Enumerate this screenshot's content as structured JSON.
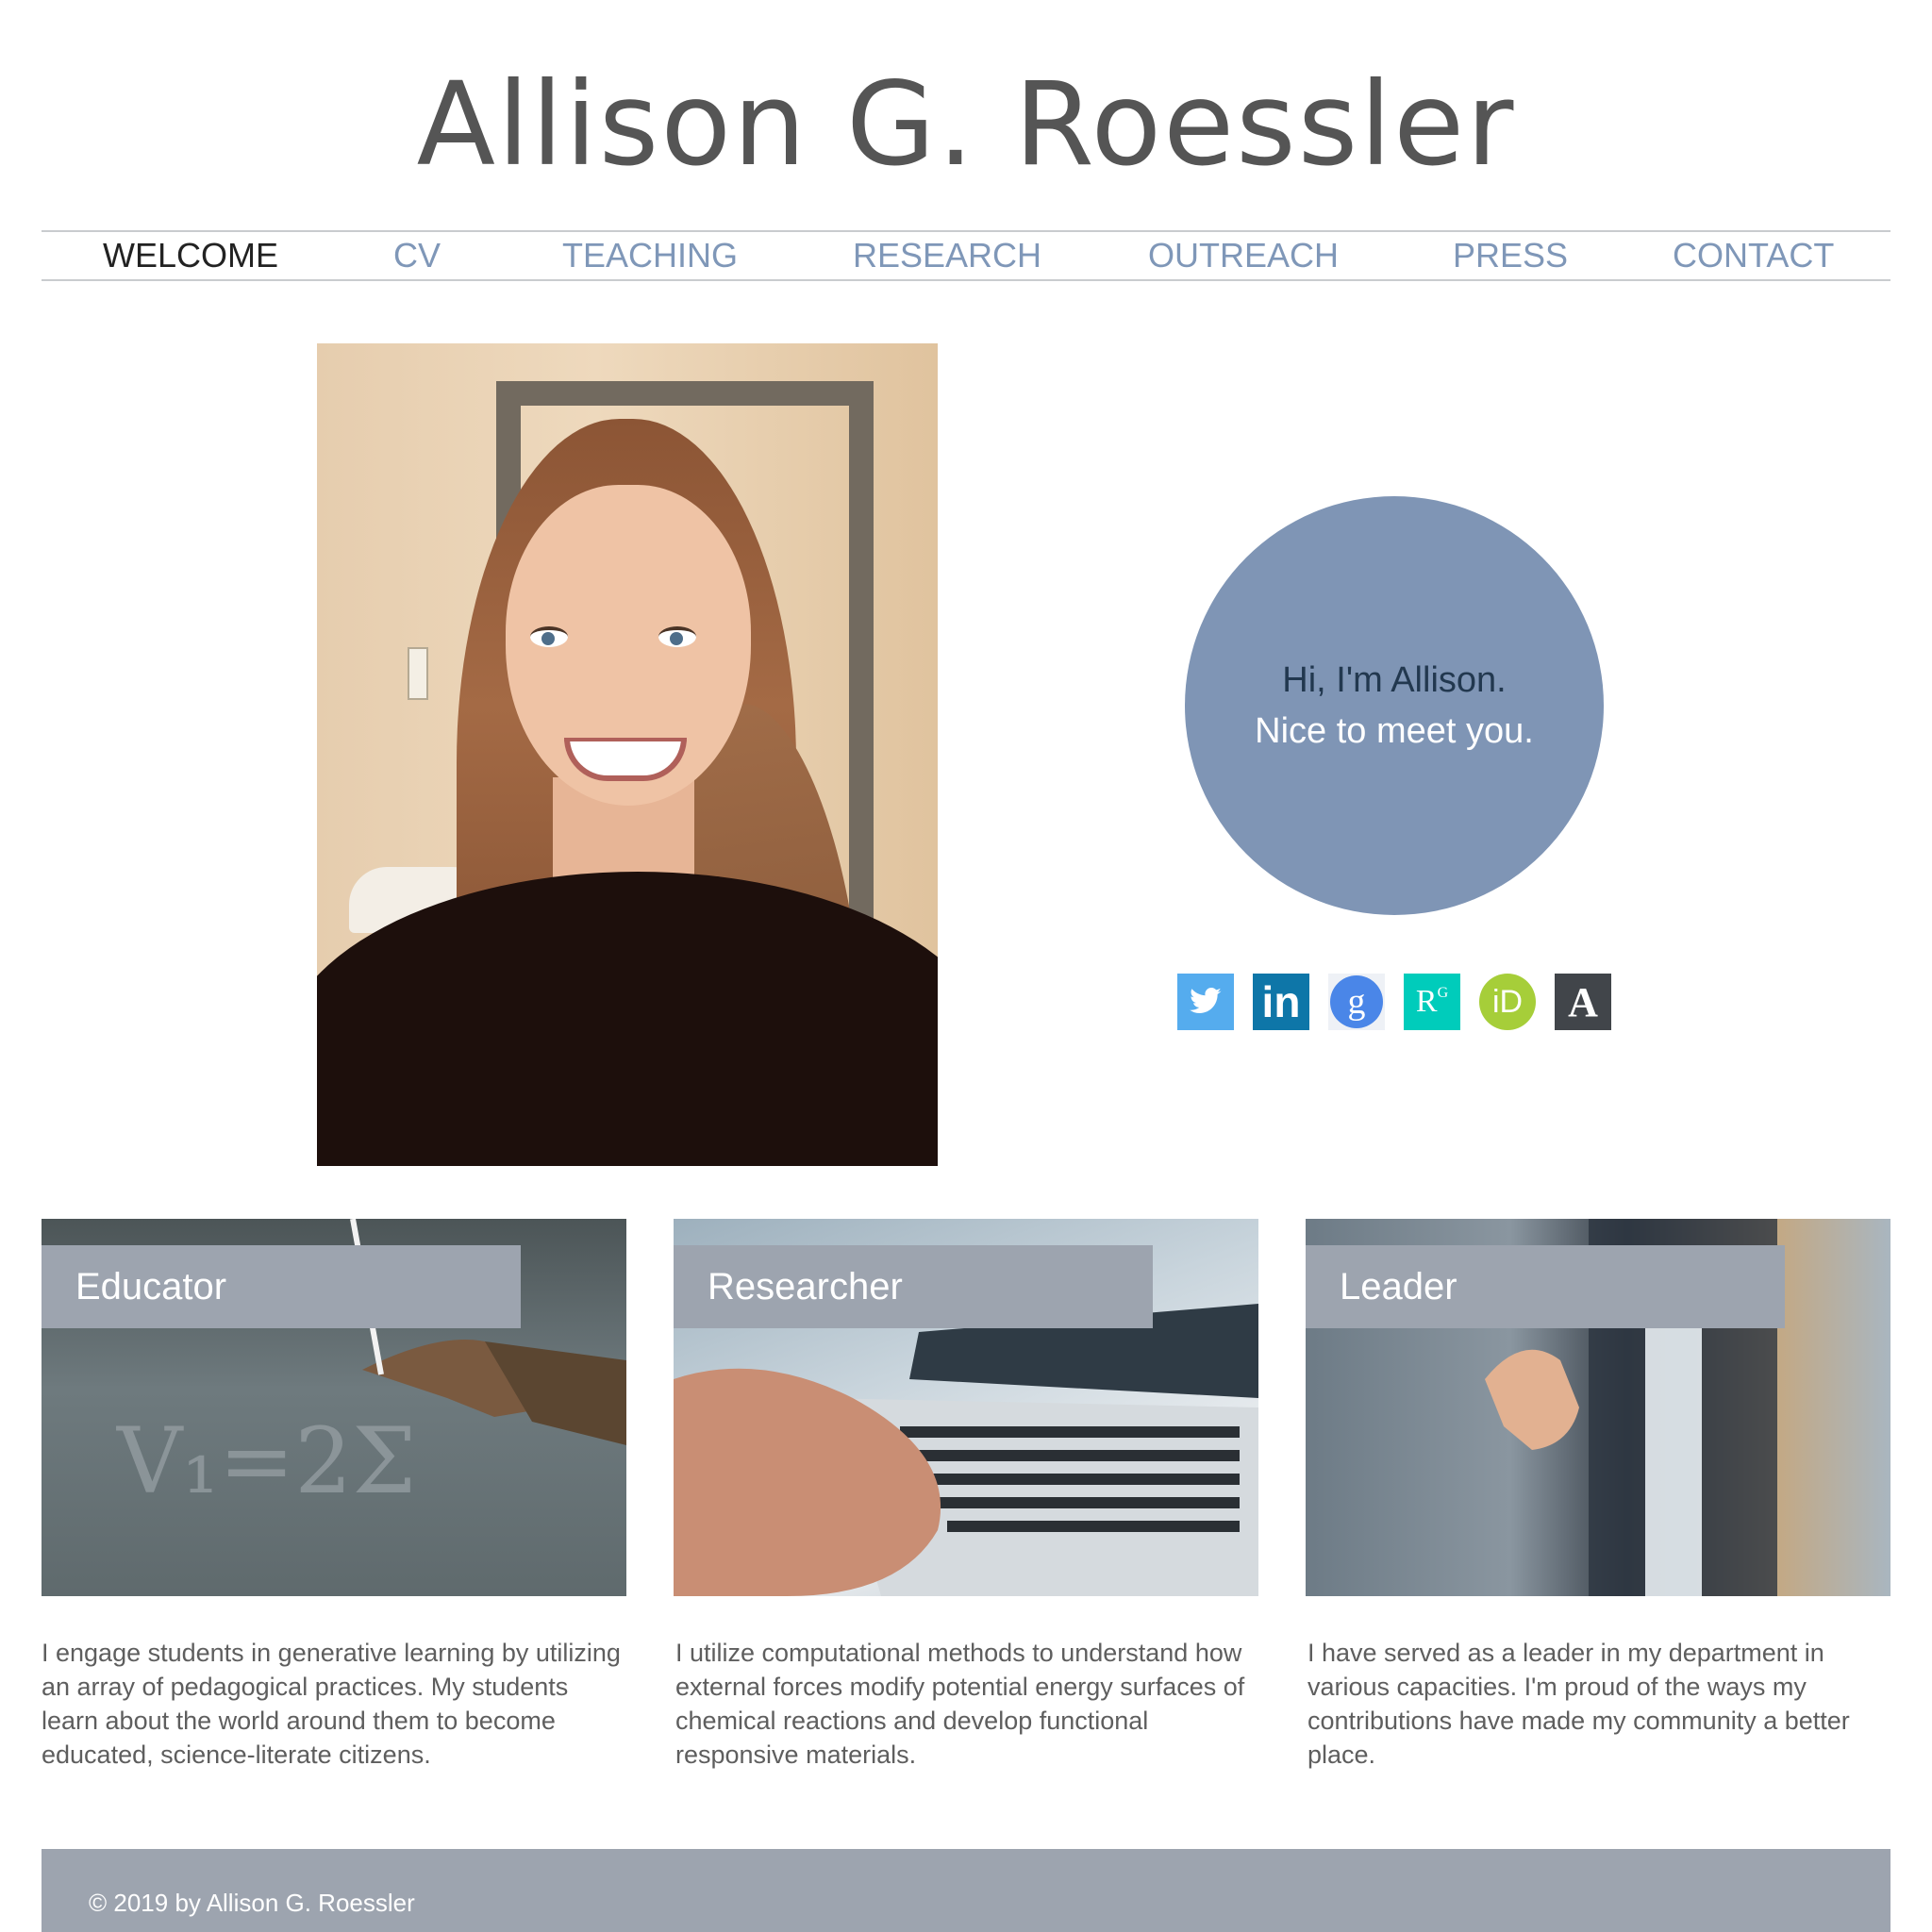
{
  "site": {
    "title": "Allison G. Roessler"
  },
  "nav": {
    "items": [
      {
        "label": "WELCOME",
        "active": true
      },
      {
        "label": "CV"
      },
      {
        "label": "TEACHING"
      },
      {
        "label": "RESEARCH"
      },
      {
        "label": "OUTREACH"
      },
      {
        "label": "PRESS"
      },
      {
        "label": "CONTACT"
      }
    ]
  },
  "hero": {
    "greeting_line1": "Hi, I'm Allison.",
    "greeting_line2": "Nice to meet you."
  },
  "social": {
    "icons": [
      "twitter-icon",
      "linkedin-icon",
      "google-scholar-icon",
      "researchgate-icon",
      "orcid-icon",
      "academia-icon"
    ],
    "researchgate_text": "R",
    "orcid_text": "iD",
    "academia_text": "A",
    "linkedin_text": "in",
    "colors": {
      "twitter": "#55acee",
      "linkedin": "#0e76a8",
      "google_scholar": "#4a86e8",
      "researchgate": "#00ccbb",
      "orcid": "#a6ce39",
      "academia": "#41454a"
    }
  },
  "cards": [
    {
      "label": "Educator",
      "text": "I engage students in generative learning by utilizing an array of pedagogical practices. My students learn about the world around them to become educated, science-literate citizens."
    },
    {
      "label": "Researcher",
      "text": "I utilize computational methods to understand how external forces modify potential energy surfaces of chemical reactions and develop functional responsive materials."
    },
    {
      "label": "Leader",
      "text": "I have served as a leader in my department in various capacities. I'm proud of the ways my contributions have made my community a better place."
    }
  ],
  "chalkboard_text": "V₁=2Σ",
  "footer": {
    "copyright": "© 2019 by Allison G. Roessler"
  },
  "colors": {
    "nav_link": "#7f97b8",
    "nav_active": "#222222",
    "accent_circle": "#7f95b5",
    "label_band": "#9da4af",
    "title": "#555555"
  }
}
